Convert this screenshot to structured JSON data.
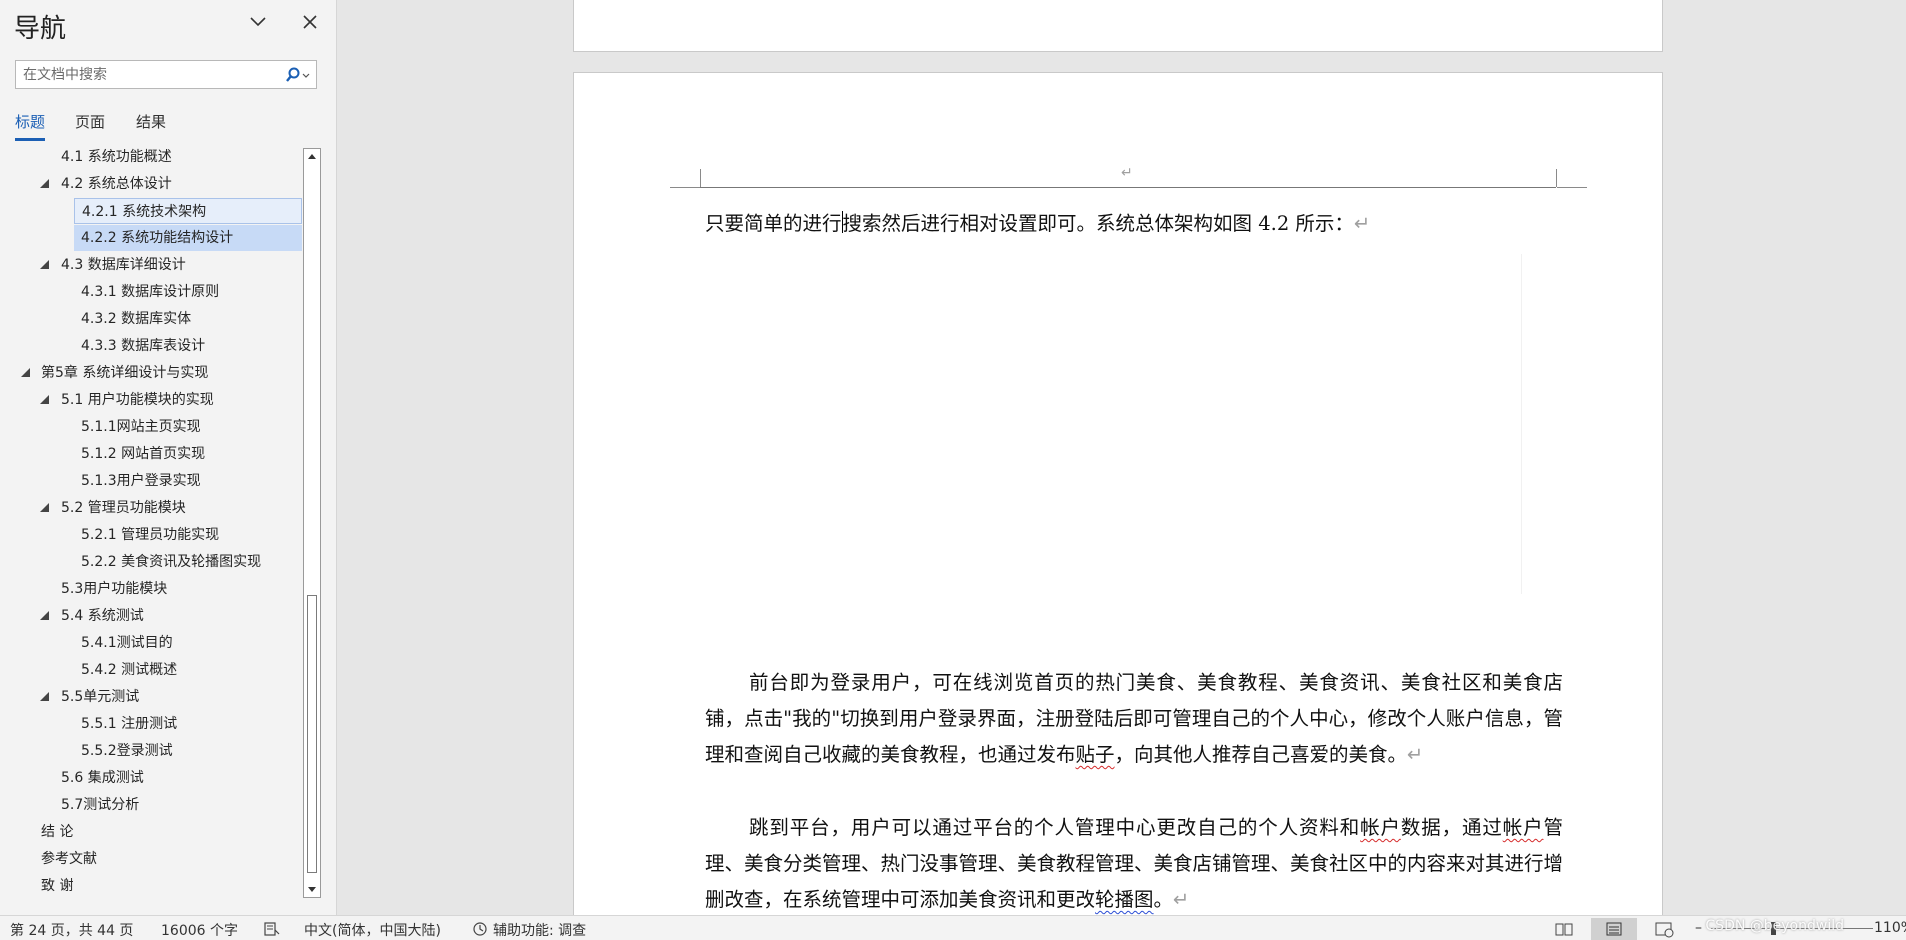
{
  "nav": {
    "title": "导航",
    "search_placeholder": "在文档中搜索",
    "tabs": [
      {
        "label": "标题",
        "active": true
      },
      {
        "label": "页面",
        "active": false
      },
      {
        "label": "结果",
        "active": false
      }
    ],
    "headings": [
      {
        "label": "4.1 系统功能概述",
        "level": 2,
        "expand": false
      },
      {
        "label": "4.2 系统总体设计",
        "level": 2,
        "expand": true
      },
      {
        "label": "4.2.1 系统技术架构",
        "level": 3,
        "expand": false
      },
      {
        "label": "4.2.2 系统功能结构设计",
        "level": 3,
        "expand": false
      },
      {
        "label": "4.3 数据库详细设计",
        "level": 2,
        "expand": true
      },
      {
        "label": "4.3.1 数据库设计原则",
        "level": 3,
        "expand": false
      },
      {
        "label": "4.3.2 数据库实体",
        "level": 3,
        "expand": false
      },
      {
        "label": "4.3.3 数据库表设计",
        "level": 3,
        "expand": false
      },
      {
        "label": "第5章  系统详细设计与实现",
        "level": 1,
        "expand": true
      },
      {
        "label": "5.1 用户功能模块的实现",
        "level": 2,
        "expand": true
      },
      {
        "label": "5.1.1网站主页实现",
        "level": 3,
        "expand": false
      },
      {
        "label": "5.1.2 网站首页实现",
        "level": 3,
        "expand": false
      },
      {
        "label": "5.1.3用户登录实现",
        "level": 3,
        "expand": false
      },
      {
        "label": "5.2 管理员功能模块",
        "level": 2,
        "expand": true
      },
      {
        "label": "5.2.1 管理员功能实现",
        "level": 3,
        "expand": false
      },
      {
        "label": "5.2.2 美食资讯及轮播图实现",
        "level": 3,
        "expand": false
      },
      {
        "label": "5.3用户功能模块",
        "level": 2,
        "expand": false
      },
      {
        "label": "5.4 系统测试",
        "level": 2,
        "expand": true
      },
      {
        "label": "5.4.1测试目的",
        "level": 3,
        "expand": false
      },
      {
        "label": "5.4.2 测试概述",
        "level": 3,
        "expand": false
      },
      {
        "label": "5.5单元测试",
        "level": 2,
        "expand": true
      },
      {
        "label": "5.5.1 注册测试",
        "level": 3,
        "expand": false
      },
      {
        "label": "5.5.2登录测试",
        "level": 3,
        "expand": false
      },
      {
        "label": "5.6 集成测试",
        "level": 2,
        "expand": false
      },
      {
        "label": "5.7测试分析",
        "level": 2,
        "expand": false
      },
      {
        "label": "结    论",
        "level": 1,
        "expand": false
      },
      {
        "label": "参考文献",
        "level": 1,
        "expand": false
      },
      {
        "label": "致    谢",
        "level": 1,
        "expand": false
      }
    ]
  },
  "document": {
    "para_mark": "↵",
    "intro_before_caret": "只要简单的进行",
    "intro_after_caret": "搜索然后进行相对设置即可。系统总体架构如图 4.2 所示：",
    "p1": {
      "a": "前台即为登录用户，可在线浏览首页的热门美食、美食教程、美食资讯、美食社区和美食店铺，点击\"我的\"切换到用户登录界面，注册登陆后即可管理自己的个人中心，修改个人账户信息，管理和查阅自己收藏的美食教程，也通过发布",
      "b": "贴子",
      "c": "，向其他人推荐自己喜爱的美食。"
    },
    "p2": {
      "a": "跳到平台，用户可以通过平台的个人管理中心更改自己的个人资料和",
      "b": "帐户",
      "c": "数据，通过",
      "d": "帐户",
      "e": "管理、美食分类管理、热门没事管理、美食教程管理、美食店铺管理、美食社区中的内容来对其进行增删改查，在系统管理中可添加美食资讯和更改",
      "f": "轮播图",
      "g": "。"
    }
  },
  "status": {
    "page": "第 24 页，共 44 页",
    "words": "16006 个字",
    "language": "中文(简体，中国大陆)",
    "accessibility": "辅助功能: 调查",
    "zoom": "110%",
    "zoom_minus": "–",
    "watermark": "CSDN @beyondwild"
  }
}
